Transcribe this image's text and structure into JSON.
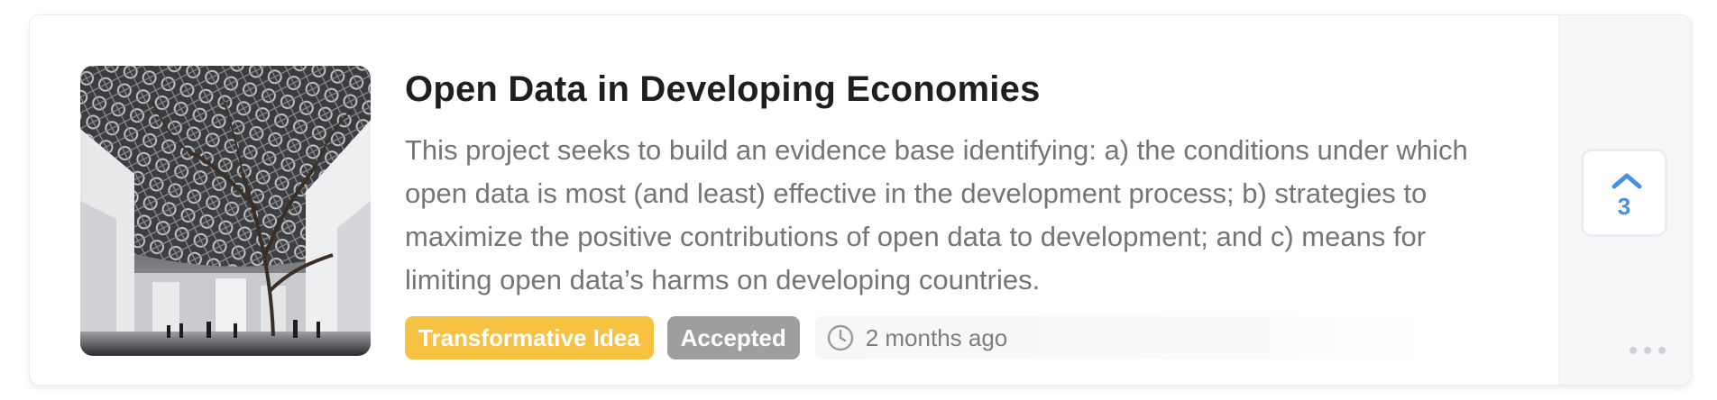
{
  "card": {
    "title": "Open Data in Developing Economies",
    "description": "This project seeks to build an evidence base identifying: a) the conditions under which open data is most (and least) effective in the development process; b) strategies to maximize the positive contributions of open data to development; and c) means for limiting open data’s harms on developing countries.",
    "tags": {
      "type_label": "Transformative Idea",
      "status_label": "Accepted"
    },
    "timestamp": "2 months ago",
    "image_icon": "museum-dome-photo"
  },
  "vote": {
    "count": "3",
    "icon": "chevron-up-icon"
  },
  "menu": {
    "icon": "more-dots-icon"
  },
  "colors": {
    "type_badge": "#f5c241",
    "status_badge": "#9e9e9e",
    "vote_accent": "#4a90e2",
    "title_text": "#1f1f1f",
    "body_text": "#757575"
  }
}
